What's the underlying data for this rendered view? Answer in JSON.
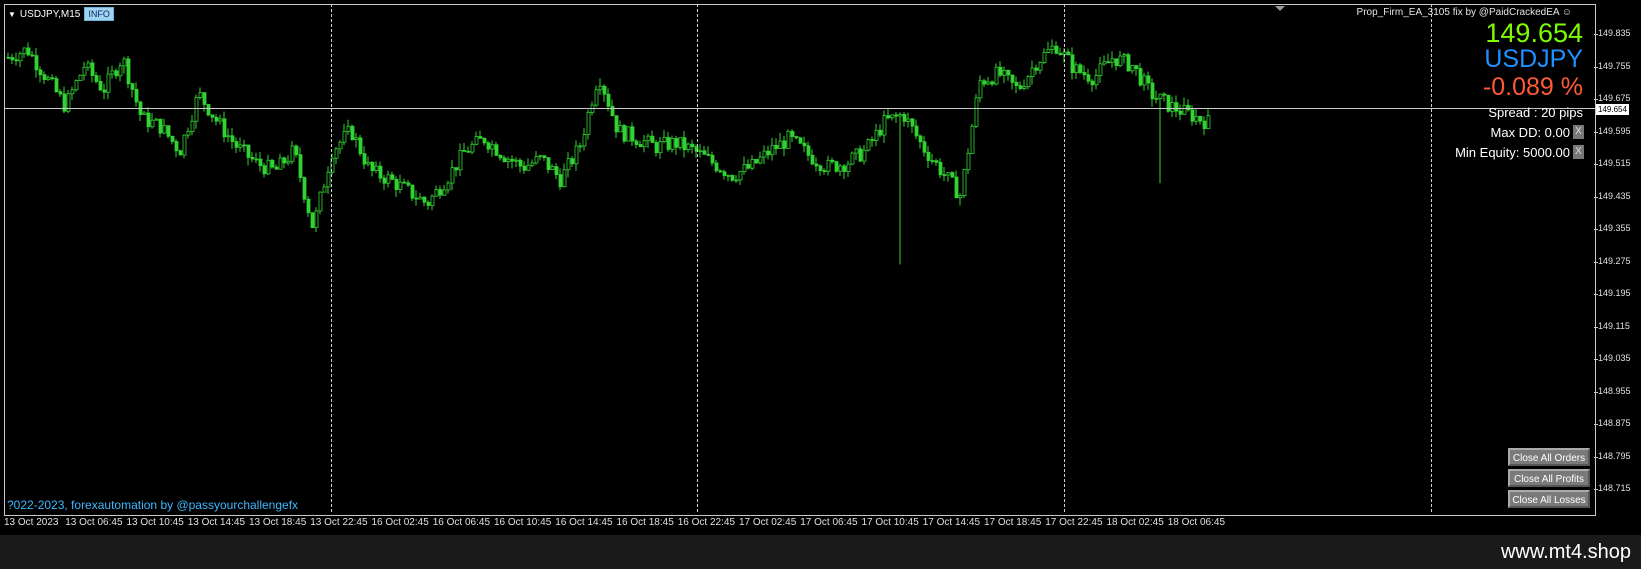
{
  "chart": {
    "symbol_label": "USDJPY,M15",
    "info_badge": "INFO",
    "ea_title": "Prop_Firm_EA_3105 fix by @PaidCrackedEA ☺",
    "current_price_tag": "149.654",
    "copyright": "?022-2023, forexautomation by @passyourchallengefx"
  },
  "overlay": {
    "price": "149.654",
    "symbol": "USDJPY",
    "change": "-0.089 %",
    "spread": "Spread : 20 pips",
    "max_dd": "Max DD: 0.00",
    "min_equity": "Min Equity: 5000.00",
    "x_label": "X"
  },
  "buttons": {
    "close_all_orders": "Close All Orders",
    "close_all_profits": "Close All Profits",
    "close_all_losses": "Close All Losses"
  },
  "price_axis": [
    "149.835",
    "149.755",
    "149.675",
    "149.595",
    "149.515",
    "149.435",
    "149.355",
    "149.275",
    "149.195",
    "149.115",
    "149.035",
    "148.955",
    "148.875",
    "148.795",
    "148.715"
  ],
  "time_axis": [
    "13 Oct 2023",
    "13 Oct 06:45",
    "13 Oct 10:45",
    "13 Oct 14:45",
    "13 Oct 18:45",
    "13 Oct 22:45",
    "16 Oct 02:45",
    "16 Oct 06:45",
    "16 Oct 10:45",
    "16 Oct 14:45",
    "16 Oct 18:45",
    "16 Oct 22:45",
    "17 Oct 02:45",
    "17 Oct 06:45",
    "17 Oct 10:45",
    "17 Oct 14:45",
    "17 Oct 18:45",
    "17 Oct 22:45",
    "18 Oct 02:45",
    "18 Oct 06:45"
  ],
  "colors": {
    "candle": "#32d232",
    "price_green": "#7cfc00",
    "symbol_blue": "#1e90ff",
    "change_red": "#ff5a36",
    "copyright_blue": "#3fb7ff"
  },
  "watermark": "www.mt4.shop",
  "chart_data": {
    "type": "candlestick",
    "ylim": [
      148.715,
      149.875
    ],
    "current_price": 149.654,
    "anchor_prices": [
      149.78,
      149.8,
      149.73,
      149.66,
      149.76,
      149.7,
      149.78,
      149.63,
      149.61,
      149.55,
      149.69,
      149.62,
      149.56,
      149.52,
      149.5,
      149.55,
      149.36,
      149.55,
      149.6,
      149.5,
      149.48,
      149.45,
      149.42,
      149.48,
      149.55,
      149.58,
      149.54,
      149.51,
      149.53,
      149.48,
      149.56,
      149.74,
      149.6,
      149.58,
      149.56,
      149.57,
      149.55,
      149.52,
      149.49,
      149.51,
      149.55,
      149.58,
      149.54,
      149.51,
      149.52,
      149.55,
      149.62,
      149.64,
      149.56,
      149.5,
      149.44,
      149.72,
      149.74,
      149.7,
      149.77,
      149.81,
      149.75,
      149.73,
      149.78,
      149.76,
      149.69,
      149.66,
      149.64,
      149.62
    ]
  }
}
